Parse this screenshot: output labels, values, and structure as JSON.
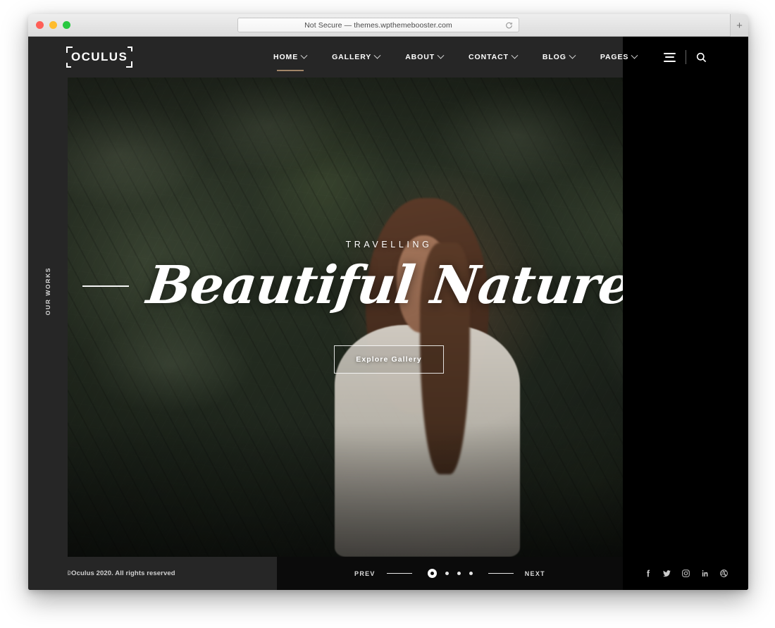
{
  "browser": {
    "url_text": "Not Secure — themes.wpthemebooster.com",
    "reload_icon": "reload-icon",
    "newtab_label": "+",
    "traffic_lights": [
      "close",
      "minimize",
      "maximize"
    ]
  },
  "header": {
    "logo": "OCULUS",
    "nav": [
      {
        "label": "HOME",
        "has_caret": true,
        "active": true
      },
      {
        "label": "GALLERY",
        "has_caret": true,
        "active": false
      },
      {
        "label": "ABOUT",
        "has_caret": true,
        "active": false
      },
      {
        "label": "CONTACT",
        "has_caret": true,
        "active": false
      },
      {
        "label": "BLOG",
        "has_caret": true,
        "active": false
      },
      {
        "label": "PAGES",
        "has_caret": true,
        "active": false
      }
    ],
    "menu_icon": "hamburger-icon",
    "search_icon": "search-icon",
    "active_underline_color": "#a18568"
  },
  "left_rail": {
    "label": "OUR WORKS"
  },
  "hero": {
    "eyebrow": "TRAVELLING",
    "title": "Beautiful Nature",
    "button_label": "Explore Gallery",
    "fullscreen_icon": "fullscreen-icon"
  },
  "footer": {
    "copyright": "©Oculus 2020. All rights reserved",
    "prev_label": "PREV",
    "next_label": "NEXT",
    "slides_total": 4,
    "active_slide": 1,
    "social": [
      {
        "name": "facebook-icon",
        "glyph": "f"
      },
      {
        "name": "twitter-icon",
        "glyph": "t"
      },
      {
        "name": "instagram-icon",
        "glyph": "ig"
      },
      {
        "name": "linkedin-icon",
        "glyph": "in"
      },
      {
        "name": "dribbble-icon",
        "glyph": "db"
      }
    ]
  },
  "colors": {
    "panel_dark": "#262626",
    "panel_black": "#000000",
    "accent": "#a18568",
    "text_light": "#ffffff"
  }
}
